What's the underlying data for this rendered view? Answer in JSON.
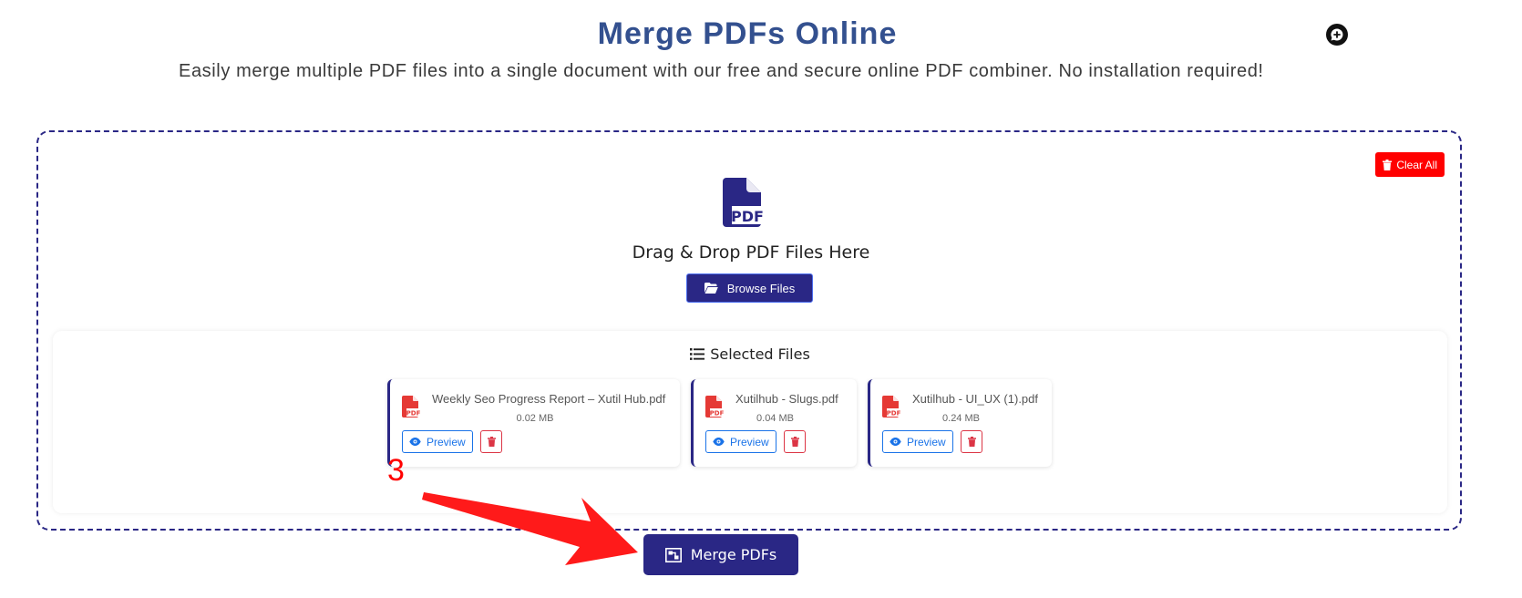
{
  "header": {
    "title": "Merge PDFs Online",
    "subtitle": "Easily merge multiple PDF files into a single document with our free and secure online PDF combiner. No installation required!",
    "chat_icon": "chat-plus-icon"
  },
  "dropzone": {
    "clear_all_label": "Clear All",
    "drop_text": "Drag & Drop PDF Files Here",
    "browse_label": "Browse Files",
    "pdf_icon_text": "PDF"
  },
  "selected": {
    "title": "Selected Files",
    "files": [
      {
        "name": "Weekly Seo Progress Report – Xutil Hub.pdf",
        "size": "0.02 MB",
        "preview_label": "Preview"
      },
      {
        "name": "Xutilhub - Slugs.pdf",
        "size": "0.04 MB",
        "preview_label": "Preview"
      },
      {
        "name": "Xutilhub - UI_UX (1).pdf",
        "size": "0.24 MB",
        "preview_label": "Preview"
      }
    ]
  },
  "actions": {
    "merge_label": "Merge PDFs"
  },
  "annotation": {
    "step_number": "3"
  },
  "colors": {
    "title": "#33508f",
    "primary": "#2a2785",
    "danger": "#ff0000",
    "pdf_red": "#e53935",
    "preview_blue": "#1a73e8"
  }
}
